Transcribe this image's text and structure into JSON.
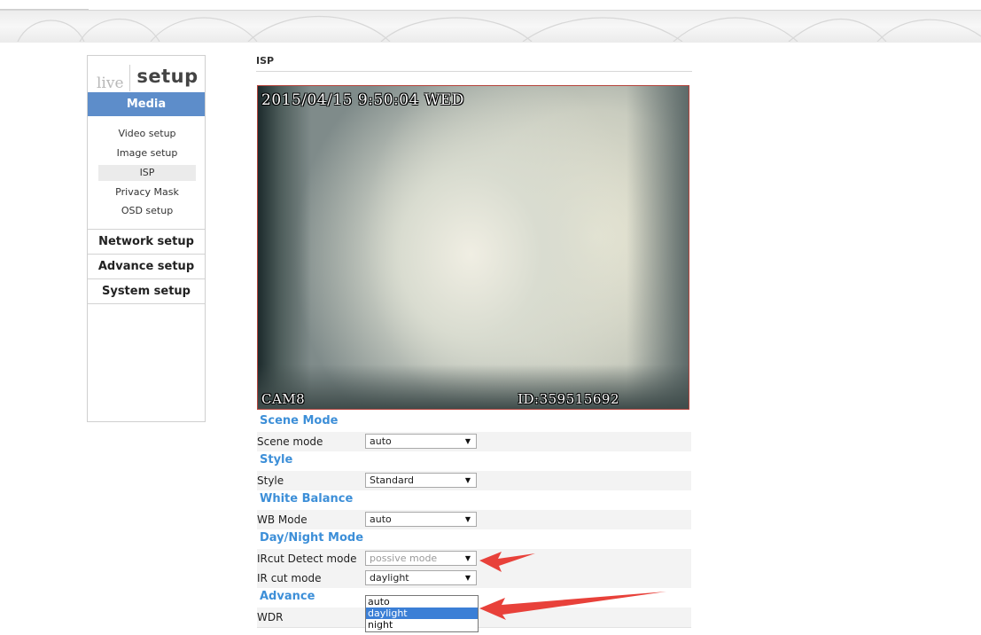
{
  "tabs": {
    "live": "live",
    "setup": "setup"
  },
  "nav": {
    "media_header": "Media",
    "media_items": [
      "Video setup",
      "Image setup",
      "ISP",
      "Privacy Mask",
      "OSD setup"
    ],
    "active_item": "ISP",
    "sections": [
      "Network setup",
      "Advance setup",
      "System setup"
    ]
  },
  "page": {
    "title": "ISP"
  },
  "video": {
    "timestamp": "2015/04/15 9:50:04 WED",
    "camera": "CAM8",
    "device_id": "ID:359515692"
  },
  "form": {
    "scene_mode": {
      "header": "Scene Mode",
      "label": "Scene mode",
      "value": "auto"
    },
    "style": {
      "header": "Style",
      "label": "Style",
      "value": "Standard"
    },
    "white_balance": {
      "header": "White Balance",
      "label": "WB Mode",
      "value": "auto"
    },
    "day_night": {
      "header": "Day/Night Mode",
      "ircut_detect_label": "IRcut Detect mode",
      "ircut_detect_value": "possive mode",
      "ir_cut_label": "IR cut mode",
      "ir_cut_value": "daylight",
      "ir_cut_options": [
        "auto",
        "daylight",
        "night"
      ],
      "ir_cut_selected": "daylight"
    },
    "advance": {
      "header": "Advance",
      "wdr_label": "WDR"
    }
  },
  "colors": {
    "accent": "#5d8dca",
    "section_heading": "#3d8fd8",
    "annotation_arrow": "#e8413a",
    "dropdown_highlight": "#3b7fd6"
  }
}
